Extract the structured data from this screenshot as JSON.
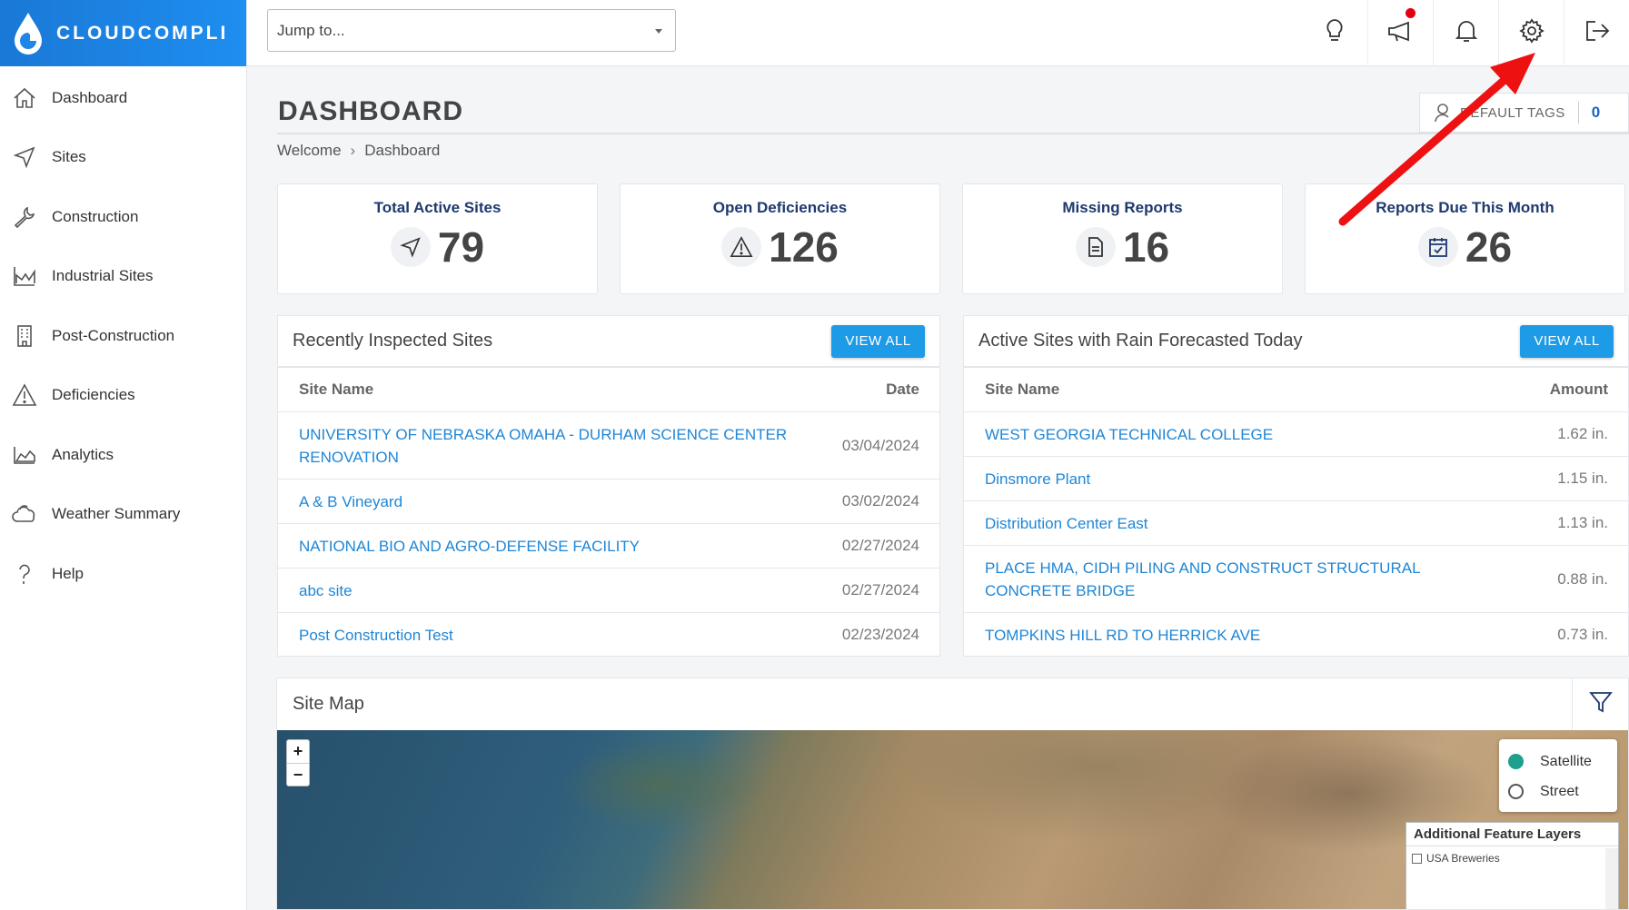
{
  "brand": {
    "name": "CLOUDCOMPLI"
  },
  "sidebar": {
    "items": [
      {
        "label": "Dashboard",
        "icon": "home-icon"
      },
      {
        "label": "Sites",
        "icon": "navigation-arrow-icon"
      },
      {
        "label": "Construction",
        "icon": "wrench-icon"
      },
      {
        "label": "Industrial Sites",
        "icon": "factory-icon"
      },
      {
        "label": "Post-Construction",
        "icon": "building-icon"
      },
      {
        "label": "Deficiencies",
        "icon": "warning-triangle-icon"
      },
      {
        "label": "Analytics",
        "icon": "area-chart-icon"
      },
      {
        "label": "Weather Summary",
        "icon": "cloud-icon"
      },
      {
        "label": "Help",
        "icon": "question-mark-icon"
      }
    ]
  },
  "topbar": {
    "jump_placeholder": "Jump to...",
    "icons": [
      "lightbulb-icon",
      "megaphone-icon",
      "bell-icon",
      "gear-icon",
      "logout-icon"
    ]
  },
  "header": {
    "title": "DASHBOARD",
    "breadcrumb": [
      "Welcome",
      "Dashboard"
    ],
    "default_tags_label": "DEFAULT TAGS",
    "default_tags_count": "0"
  },
  "stats": [
    {
      "label": "Total Active Sites",
      "value": "79",
      "icon": "navigation-arrow-icon"
    },
    {
      "label": "Open Deficiencies",
      "value": "126",
      "icon": "warning-triangle-icon"
    },
    {
      "label": "Missing Reports",
      "value": "16",
      "icon": "document-icon"
    },
    {
      "label": "Reports Due This Month",
      "value": "26",
      "icon": "calendar-check-icon"
    }
  ],
  "recent": {
    "title": "Recently Inspected Sites",
    "button": "VIEW ALL",
    "columns": [
      "Site Name",
      "Date"
    ],
    "rows": [
      {
        "name": "UNIVERSITY OF NEBRASKA OMAHA - DURHAM SCIENCE CENTER RENOVATION",
        "value": "03/04/2024"
      },
      {
        "name": "A & B Vineyard",
        "value": "03/02/2024"
      },
      {
        "name": "NATIONAL BIO AND AGRO-DEFENSE FACILITY",
        "value": "02/27/2024"
      },
      {
        "name": "abc site",
        "value": "02/27/2024"
      },
      {
        "name": "Post Construction Test",
        "value": "02/23/2024"
      }
    ]
  },
  "rain": {
    "title": "Active Sites with Rain Forecasted Today",
    "button": "VIEW ALL",
    "columns": [
      "Site Name",
      "Amount"
    ],
    "rows": [
      {
        "name": "WEST GEORGIA TECHNICAL COLLEGE",
        "value": "1.62 in."
      },
      {
        "name": "Dinsmore Plant",
        "value": "1.15 in."
      },
      {
        "name": "Distribution Center East",
        "value": "1.13 in."
      },
      {
        "name": "PLACE HMA, CIDH PILING AND CONSTRUCT STRUCTURAL CONCRETE BRIDGE",
        "value": "0.88 in."
      },
      {
        "name": "TOMPKINS HILL RD TO HERRICK AVE",
        "value": "0.73 in."
      }
    ]
  },
  "map": {
    "title": "Site Map",
    "zoom_in": "+",
    "zoom_out": "−",
    "basemaps": [
      {
        "label": "Satellite",
        "selected": true
      },
      {
        "label": "Street",
        "selected": false
      }
    ],
    "layers_title": "Additional Feature Layers",
    "layers": [
      {
        "label": "USA Breweries",
        "checked": false
      }
    ]
  },
  "colors": {
    "brand_blue": "#1e8ef0",
    "link": "#1e86d6",
    "stat_label": "#1e3a6e",
    "button": "#1e9be6",
    "annotation_arrow": "#ee1111"
  }
}
